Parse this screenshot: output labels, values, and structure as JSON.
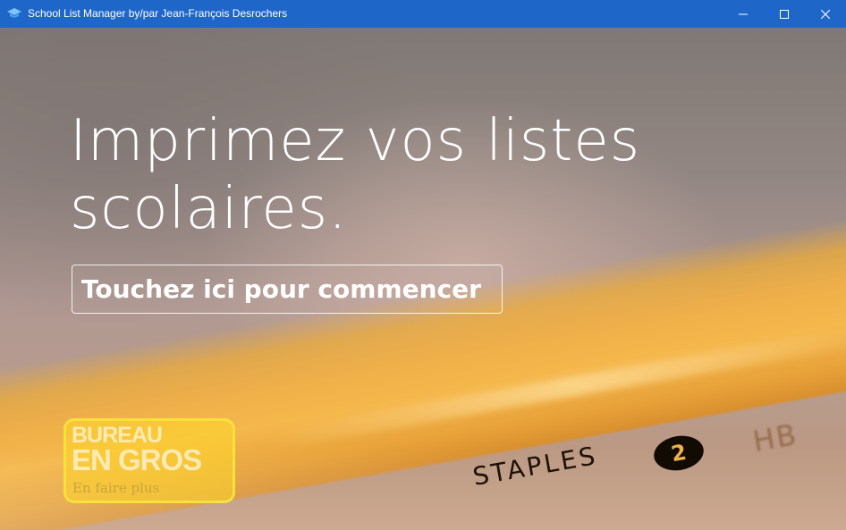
{
  "window": {
    "title": "School List Manager by/par Jean-François Desrochers",
    "app_icon": "graduation-cap-icon",
    "controls": {
      "minimize_icon": "minimize-icon",
      "maximize_icon": "maximize-icon",
      "close_icon": "close-icon"
    },
    "titlebar_color": "#1f66c9"
  },
  "hero": {
    "headline_line1": "Imprimez vos listes",
    "headline_line2": "scolaires.",
    "cta_label": "Touchez ici pour commencer"
  },
  "logo": {
    "line1": "BUREAU",
    "line2": "EN GROS",
    "tagline": "En faire plus",
    "border_color": "#f6e23a"
  },
  "background_image": {
    "pencil_brand": "STAPLES",
    "pencil_number": "2",
    "pencil_grade": "HB",
    "pencil_color": "#f0b04a"
  }
}
